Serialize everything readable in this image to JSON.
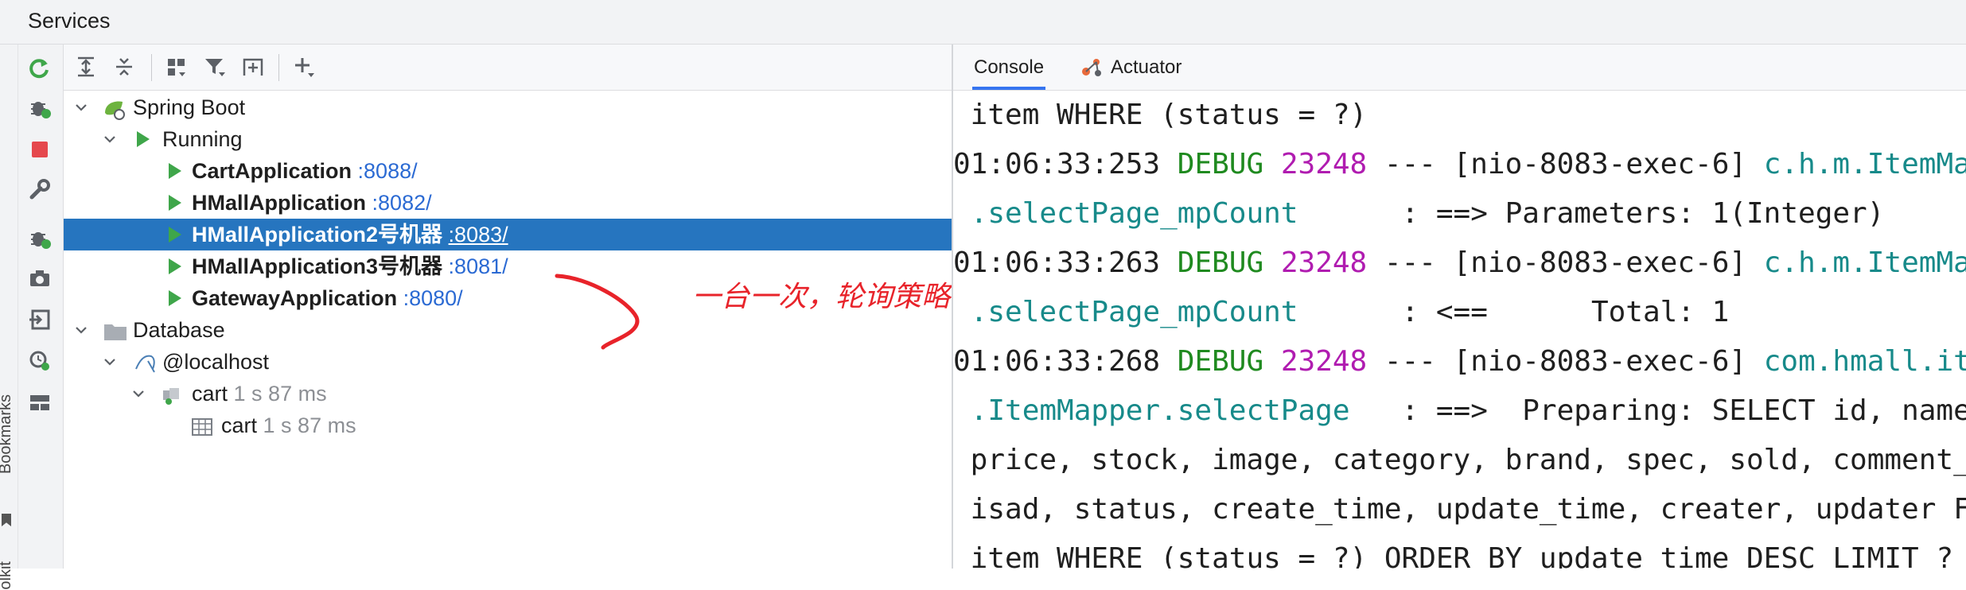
{
  "title": "Services",
  "side_labels": {
    "bookmarks": "Bookmarks",
    "bottom": "olkit"
  },
  "toolbar_icons": [
    "expand-all-icon",
    "collapse-all-icon",
    "group-by-icon",
    "filter-icon",
    "new-tab-icon",
    "add-service-icon"
  ],
  "leftbar_icons": [
    "rerun-icon",
    "debug-icon",
    "stop-icon",
    "wrench-icon",
    "debug-service-icon",
    "camera-icon",
    "sign-in-icon",
    "profiler-icon",
    "layout-icon"
  ],
  "tree": {
    "spring_boot": "Spring Boot",
    "running": "Running",
    "apps": [
      {
        "name": "CartApplication",
        "port": ":8088/",
        "selected": false
      },
      {
        "name": "HMallApplication",
        "port": ":8082/",
        "selected": false
      },
      {
        "name": "HMallApplication2号机器",
        "port": ":8083/",
        "selected": true
      },
      {
        "name": "HMallApplication3号机器",
        "port": ":8081/",
        "selected": false
      },
      {
        "name": "GatewayApplication",
        "port": ":8080/",
        "selected": false
      }
    ],
    "database": "Database",
    "localhost": "@localhost",
    "schema": {
      "name": "cart",
      "time": "1 s 87 ms"
    },
    "table": {
      "name": "cart",
      "time": "1 s 87 ms"
    }
  },
  "annotation": "一台一次，轮询策略",
  "tabs": {
    "console": "Console",
    "actuator": "Actuator"
  },
  "console": {
    "l1": " item WHERE (status = ?)",
    "l2_time": "01:06:33:253",
    "l2_level": "DEBUG",
    "l2_pid": "23248",
    "l2_mid": " --- [nio-8083-exec-6] ",
    "l2_logger": "c.h.m.ItemMapper",
    "l3_logger": " .selectPage_mpCount",
    "l3_msg": "      : ==> Parameters: 1(Integer)",
    "l4_time": "01:06:33:263",
    "l4_level": "DEBUG",
    "l4_pid": "23248",
    "l4_mid": " --- [nio-8083-exec-6] ",
    "l4_logger": "c.h.m.ItemMapper",
    "l5_logger": " .selectPage_mpCount",
    "l5_msg": "      : <==      Total: 1",
    "l6_time": "01:06:33:268",
    "l6_level": "DEBUG",
    "l6_pid": "23248",
    "l6_mid": " --- [nio-8083-exec-6] ",
    "l6_logger": "com.hmall.item.mapper",
    "l7_logger": " .ItemMapper.selectPage",
    "l7_msg": "   : ==>  Preparing: SELECT id, name,",
    "l8": " price, stock, image, category, brand, spec, sold, comment_count,",
    "l9": " isad, status, create_time, update_time, creater, updater FROM",
    "l10": " item WHERE (status = ?) ORDER BY update_time DESC LIMIT ?"
  }
}
